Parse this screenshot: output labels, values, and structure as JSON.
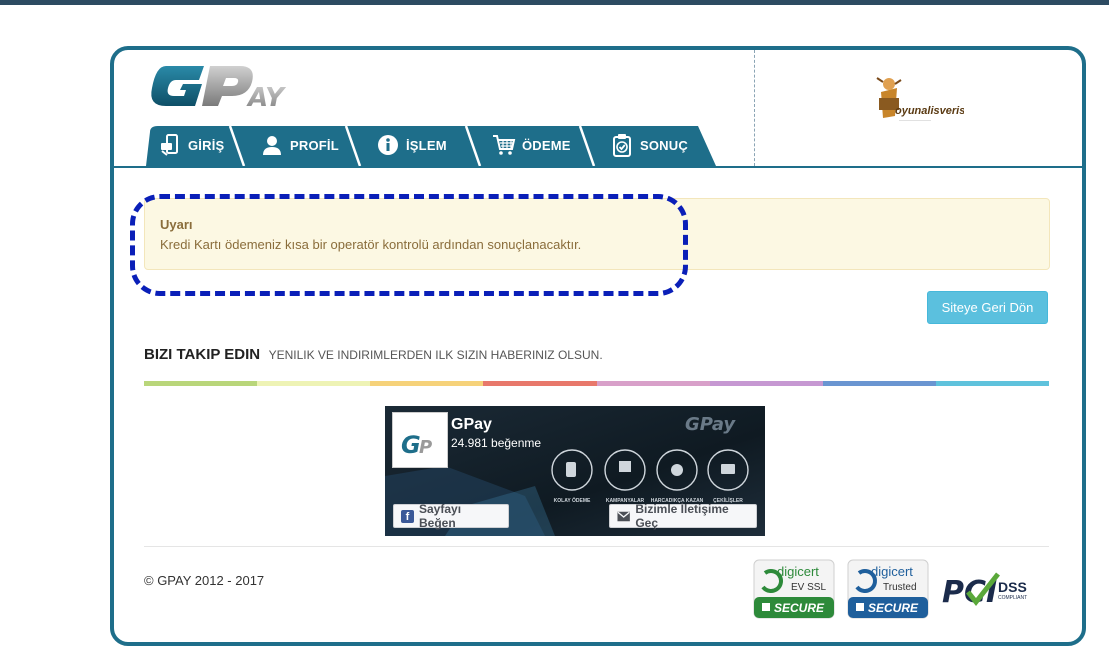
{
  "brand": {
    "logo_text": "GPAY"
  },
  "merchant": {
    "name": "oyunalisveris"
  },
  "tabs": [
    {
      "label": "GİRİŞ",
      "icon": "phone-card-icon"
    },
    {
      "label": "PROFİL",
      "icon": "user-icon"
    },
    {
      "label": "İŞLEM",
      "icon": "info-icon"
    },
    {
      "label": "ÖDEME",
      "icon": "cart-icon"
    },
    {
      "label": "SONUÇ",
      "icon": "clipboard-check-icon"
    }
  ],
  "alert": {
    "title": "Uyarı",
    "message": "Kredi Kartı ödemeniz kısa bir operatör kontrolü ardından sonuçlanacaktır."
  },
  "back_button": "Siteye Geri Dön",
  "follow": {
    "title": "BIZI TAKIP EDIN",
    "subtitle": "YENILIK VE INDIRIMLERDEN ILK SIZIN HABERINIZ OLSUN."
  },
  "color_bar": [
    "#b9d67a",
    "#eef3b5",
    "#f6d27a",
    "#e8786b",
    "#d8a0c9",
    "#c698d2",
    "#6a95d1",
    "#5fc2dc"
  ],
  "facebook": {
    "page_name": "GPay",
    "likes": "24.981 beğenme",
    "like_button": "Sayfayı Beğen",
    "message_button": "Bizimle İletişime Geç",
    "features": [
      "KOLAY ÖDEME",
      "KAMPANYALAR",
      "HARCADIKÇA KAZAN",
      "ÇEKİLİŞLER"
    ]
  },
  "footer": {
    "copyright": "© GPAY 2012 - 2017",
    "badges": [
      {
        "brand": "digicert",
        "line2": "EV SSL",
        "secure": "SECURE",
        "color": "#2d8a3a"
      },
      {
        "brand": "digicert",
        "line2": "Trusted",
        "secure": "SECURE",
        "color": "#1f5f9c"
      },
      {
        "brand": "PCI",
        "line2": "DSS",
        "secure": "COMPLIANT",
        "color": "#1b2b4b"
      }
    ]
  },
  "colors": {
    "frame": "#1e6e8a",
    "tab": "#1e6e8a",
    "info_button": "#5bc0de",
    "alert_bg": "#fcf8e3",
    "highlight": "#0a1fb8"
  }
}
